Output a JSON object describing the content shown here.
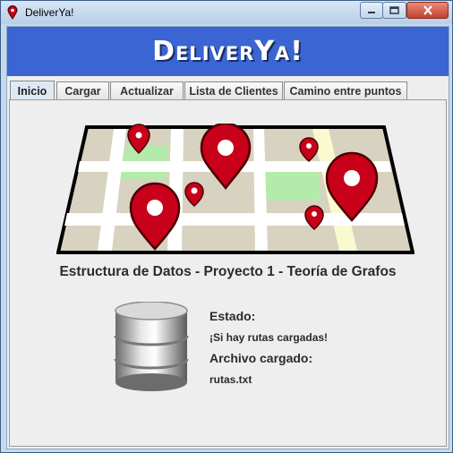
{
  "window": {
    "title": "DeliverYa!"
  },
  "banner": {
    "title": "DeliverYa!"
  },
  "tabs": [
    {
      "label": "Inicio",
      "active": true
    },
    {
      "label": "Cargar",
      "active": false
    },
    {
      "label": "Actualizar",
      "active": false
    },
    {
      "label": "Lista de Clientes",
      "active": false
    },
    {
      "label": "Camino entre puntos",
      "active": false
    }
  ],
  "home": {
    "subtitle": "Estructura de Datos - Proyecto 1 - Teoría de Grafos",
    "status_label": "Estado:",
    "status_value": "¡Si hay rutas cargadas!",
    "file_label": "Archivo cargado:",
    "file_value": "rutas.txt"
  },
  "icons": {
    "app": "map-pin-icon",
    "map": "map-illustration",
    "database": "database-icon"
  },
  "colors": {
    "banner": "#3a65d2",
    "pin": "#c8001a",
    "close_button": "#c7432e"
  }
}
